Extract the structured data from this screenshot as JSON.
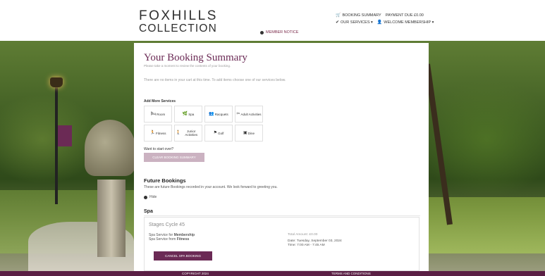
{
  "brand": {
    "line1": "FOXHILLS",
    "line2": "COLLECTION"
  },
  "header": {
    "member_notice": "MEMBER NOTICE",
    "booking_summary": "BOOKING SUMMARY",
    "payment_due": "PAYMENT DUE £0.00",
    "our_services": "OUR SERVICES ▾",
    "welcome": "WELCOME MEMBERSHIP ▾"
  },
  "page": {
    "title": "Your Booking Summary",
    "subtitle": "Please take a moment to review the contents of your booking.",
    "empty_message": "There are no items in your cart at this time. To add items choose one of our services below.",
    "add_more_label": "Add More Services",
    "start_over_label": "Want to start over?",
    "clear_button": "CLEAR BOOKING SUMMARY"
  },
  "services": [
    {
      "label": "Room",
      "icon": "bed-icon",
      "glyph": "🛏"
    },
    {
      "label": "Spa",
      "icon": "leaf-icon",
      "glyph": "🌿"
    },
    {
      "label": "Racquets",
      "icon": "users-icon",
      "glyph": "👥"
    },
    {
      "label": "Adult Activities",
      "icon": "scissors-icon",
      "glyph": "✂"
    },
    {
      "label": "Fitness",
      "icon": "runner-icon",
      "glyph": "🏃"
    },
    {
      "label": "Junior Activities",
      "icon": "child-icon",
      "glyph": "🚶"
    },
    {
      "label": "Golf",
      "icon": "flag-icon",
      "glyph": "⚑"
    },
    {
      "label": "Dine",
      "icon": "dine-icon",
      "glyph": "▣"
    }
  ],
  "future": {
    "title": "Future Bookings",
    "description": "These are future Bookings recorded in your account. We look forward to greeting you.",
    "hide_label": "Hide"
  },
  "spa": {
    "section_title": "Spa",
    "booking": {
      "name": "Stages Cycle 45",
      "service_for_prefix": "Spa Service for ",
      "service_for": "Membership",
      "service_from_prefix": "Spa Service from ",
      "service_from": "Fitness",
      "total": "Total Amount: £0.00",
      "date": "Date: Tuesday, September 03, 2024",
      "time": "Time: 7:00 AM - 7:45 AM",
      "cancel_button": "CANCEL SPA BOOKING"
    }
  },
  "footer": {
    "copyright": "COPYRIGHT 2024",
    "terms": "TERMS AND CONDITIONS"
  },
  "colors": {
    "brand": "#6b2a55",
    "footer": "#5a1f44",
    "clear_button": "#cbb2c1"
  }
}
